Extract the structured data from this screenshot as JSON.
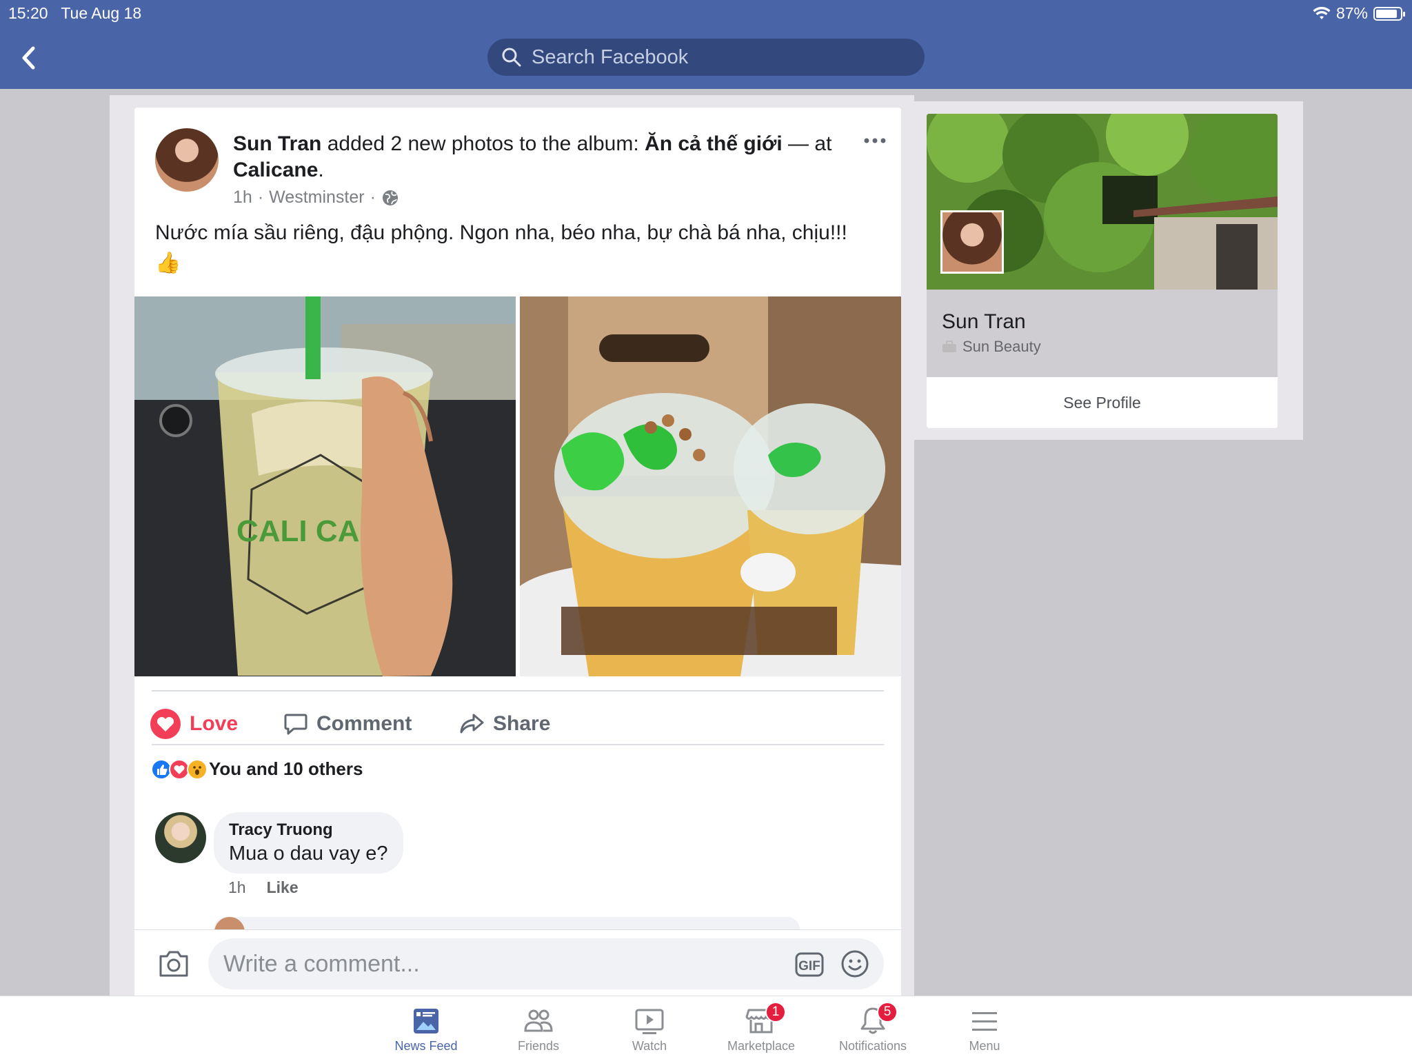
{
  "status_bar": {
    "time": "15:20",
    "date": "Tue Aug 18",
    "battery": "87%",
    "battery_level": 0.87
  },
  "header": {
    "search_placeholder": "Search Facebook"
  },
  "post": {
    "author": "Sun Tran",
    "action_text": " added 2 new photos to the album: ",
    "album": "Ăn cả thế giới",
    "at_text": " — at ",
    "place": "Calicane",
    "time": "1h",
    "location": "Westminster",
    "text": "Nước mía sầu riêng, đậu phộng. Ngon nha, béo nha, bự chà bá nha, chịu!!!",
    "emoji": "👍",
    "photo1_caption": "CALI CANE"
  },
  "actions": {
    "love": "Love",
    "comment": "Comment",
    "share": "Share"
  },
  "reactions": {
    "summary": "You and 10 others"
  },
  "comment": {
    "author": "Tracy Truong",
    "text": "Mua o dau vay e?",
    "time": "1h",
    "like": "Like"
  },
  "composer": {
    "placeholder": "Write a comment...",
    "gif": "GIF"
  },
  "profile_card": {
    "name": "Sun Tran",
    "subtitle": "Sun Beauty",
    "see_profile": "See Profile"
  },
  "tabbar": {
    "items": [
      {
        "label": "News Feed",
        "icon": "news-feed-icon",
        "active": true
      },
      {
        "label": "Friends",
        "icon": "friends-icon"
      },
      {
        "label": "Watch",
        "icon": "watch-icon"
      },
      {
        "label": "Marketplace",
        "icon": "marketplace-icon",
        "badge": "1"
      },
      {
        "label": "Notifications",
        "icon": "notifications-icon",
        "badge": "5"
      },
      {
        "label": "Menu",
        "icon": "menu-icon"
      }
    ]
  },
  "colors": {
    "brand": "#4a64a8",
    "love": "#f33e58",
    "badge": "#e41e3f"
  }
}
